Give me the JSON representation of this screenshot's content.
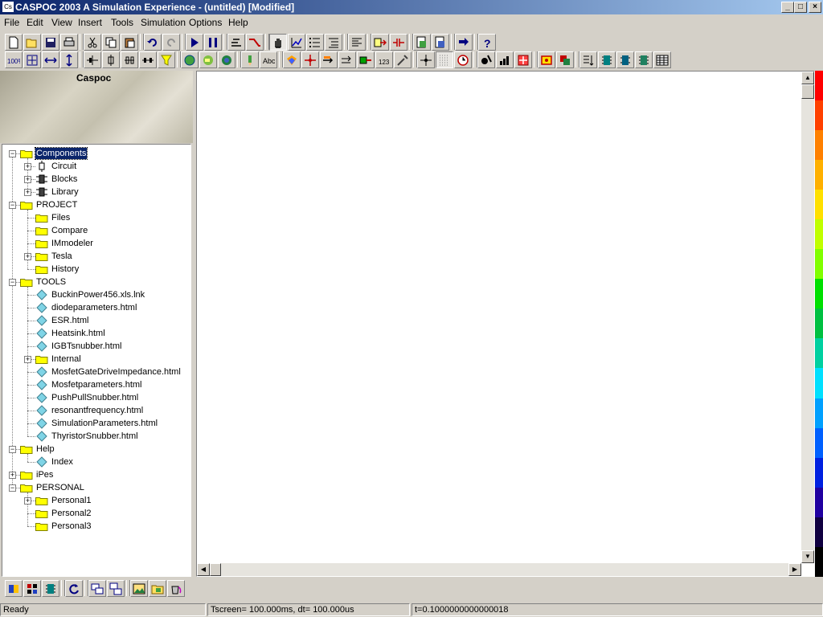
{
  "window": {
    "title": "CASPOC 2003 A Simulation Experience - (untitled) [Modified]",
    "icon_label": "Cs",
    "controls": {
      "minimize": "_",
      "maximize": "□",
      "close": "×"
    }
  },
  "menu": [
    "File",
    "Edit",
    "View",
    "Insert",
    "Tools",
    "Simulation",
    "Options",
    "Help"
  ],
  "toolbar": {
    "row1_icons": [
      "new-file-icon",
      "open-folder-icon",
      "save-icon",
      "print-icon",
      "cut-icon",
      "copy-icon",
      "paste-icon",
      "undo-icon",
      "redo-icon",
      "play-icon",
      "pause-icon",
      "hierarchy-icon",
      "connect-wire-icon",
      "hand-pan-icon",
      "graph-edit-icon",
      "list-icon",
      "list-indent-icon",
      "list-sort-icon",
      "arrow-in-icon",
      "capacitor-icon",
      "export-icon",
      "import-icon",
      "flip-icon",
      "help-icon"
    ],
    "row2_icons": [
      "zoom-100-icon",
      "zoom-fit-icon",
      "zoom-width-icon",
      "zoom-height-icon",
      "align-horizontal-icon",
      "align-vertical-icon",
      "distribute-h-icon",
      "distribute-v-icon",
      "filter-icon",
      "globe-network-icon",
      "globe-map-icon",
      "globe-icon",
      "pencil-icon",
      "text-label-icon",
      "layers-icon",
      "node-red-icon",
      "arrow-right-icon",
      "arrow-double-icon",
      "block-icon",
      "numbering-icon",
      "tool-icon",
      "crosshair-icon",
      "grid-icon",
      "clock-icon",
      "droplet-icon",
      "bar-chart-icon",
      "target-icon",
      "scope-icon",
      "warning-block-icon",
      "sort-list-icon",
      "chip-icon",
      "chip2-icon",
      "chip3-icon",
      "table-icon"
    ],
    "bottom_icons": [
      "components-icon",
      "blocks-icon",
      "chip-icon",
      "refresh-icon",
      "windows-icon",
      "windows-cascade-icon",
      "image-icon",
      "folder-image-icon",
      "bucket-icon"
    ],
    "row1_pressed": [
      "hand-pan-icon"
    ],
    "row2_pressed": [
      "grid-icon"
    ]
  },
  "sidebar": {
    "logo_text": "Caspoc",
    "tree": [
      {
        "label": "Components",
        "level": 0,
        "type": "folder",
        "expander": "−",
        "selected": true
      },
      {
        "label": "Circuit",
        "level": 1,
        "type": "circuit",
        "expander": "+"
      },
      {
        "label": "Blocks",
        "level": 1,
        "type": "blocks",
        "expander": "+"
      },
      {
        "label": "Library",
        "level": 1,
        "type": "blocks",
        "expander": "+"
      },
      {
        "label": "PROJECT",
        "level": 0,
        "type": "folder",
        "expander": "−"
      },
      {
        "label": "Files",
        "level": 1,
        "type": "folder",
        "expander": ""
      },
      {
        "label": "Compare",
        "level": 1,
        "type": "folder",
        "expander": ""
      },
      {
        "label": "IMmodeler",
        "level": 1,
        "type": "folder",
        "expander": ""
      },
      {
        "label": "Tesla",
        "level": 1,
        "type": "folder",
        "expander": "+"
      },
      {
        "label": "History",
        "level": 1,
        "type": "folder",
        "expander": ""
      },
      {
        "label": "TOOLS",
        "level": 0,
        "type": "folder",
        "expander": "−"
      },
      {
        "label": "BuckinPower456.xls.lnk",
        "level": 1,
        "type": "doc",
        "expander": ""
      },
      {
        "label": "diodeparameters.html",
        "level": 1,
        "type": "doc",
        "expander": ""
      },
      {
        "label": "ESR.html",
        "level": 1,
        "type": "doc",
        "expander": ""
      },
      {
        "label": "Heatsink.html",
        "level": 1,
        "type": "doc",
        "expander": ""
      },
      {
        "label": "IGBTsnubber.html",
        "level": 1,
        "type": "doc",
        "expander": ""
      },
      {
        "label": "Internal",
        "level": 1,
        "type": "folder",
        "expander": "+"
      },
      {
        "label": "MosfetGateDriveImpedance.html",
        "level": 1,
        "type": "doc",
        "expander": ""
      },
      {
        "label": "Mosfetparameters.html",
        "level": 1,
        "type": "doc",
        "expander": ""
      },
      {
        "label": "PushPullSnubber.html",
        "level": 1,
        "type": "doc",
        "expander": ""
      },
      {
        "label": "resonantfrequency.html",
        "level": 1,
        "type": "doc",
        "expander": ""
      },
      {
        "label": "SimulationParameters.html",
        "level": 1,
        "type": "doc",
        "expander": ""
      },
      {
        "label": "ThyristorSnubber.html",
        "level": 1,
        "type": "doc",
        "expander": ""
      },
      {
        "label": "Help",
        "level": 0,
        "type": "folder",
        "expander": "−"
      },
      {
        "label": "Index",
        "level": 1,
        "type": "doc",
        "expander": ""
      },
      {
        "label": "iPes",
        "level": 0,
        "type": "folder",
        "expander": "+"
      },
      {
        "label": "PERSONAL",
        "level": 0,
        "type": "folder",
        "expander": "−"
      },
      {
        "label": "Personal1",
        "level": 1,
        "type": "folder",
        "expander": "+"
      },
      {
        "label": "Personal2",
        "level": 1,
        "type": "folder",
        "expander": ""
      },
      {
        "label": "Personal3",
        "level": 1,
        "type": "folder",
        "expander": ""
      }
    ]
  },
  "scrollbars": {
    "up": "▲",
    "down": "▼",
    "left": "◀",
    "right": "▶"
  },
  "colors": {
    "title_start": "#0a246a",
    "title_end": "#a6caf0",
    "folder": "#ffff00",
    "doc": "#7fd4e6",
    "selection": "#0a246a",
    "color_scale": [
      "#ff0000",
      "#ff4000",
      "#ff8000",
      "#ffb000",
      "#ffe000",
      "#c0ff00",
      "#80ff00",
      "#00e000",
      "#00c040",
      "#00d0a0",
      "#00e0ff",
      "#00a0ff",
      "#0060ff",
      "#0020e0",
      "#2000a0",
      "#100040",
      "#000000"
    ]
  },
  "status": {
    "state": "Ready",
    "timing": "Tscreen= 100.000ms, dt= 100.000us",
    "time": "t=0.1000000000000018"
  }
}
